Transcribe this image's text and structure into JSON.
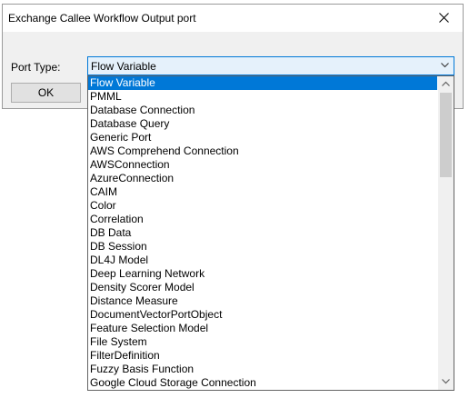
{
  "window": {
    "title": "Exchange Callee Workflow Output port",
    "close_icon": "close-icon"
  },
  "form": {
    "port_type_label": "Port Type:",
    "ok_label": "OK",
    "selected_value": "Flow Variable"
  },
  "dropdown": {
    "items": [
      "Flow Variable",
      "PMML",
      "Database Connection",
      "Database Query",
      "Generic Port",
      "AWS Comprehend Connection",
      "AWSConnection",
      "AzureConnection",
      "CAIM",
      "Color",
      "Correlation",
      "DB Data",
      "DB Session",
      "DL4J Model",
      "Deep Learning Network",
      "Density Scorer Model",
      "Distance Measure",
      "DocumentVectorPortObject",
      "Feature Selection Model",
      "File System",
      "FilterDefinition",
      "Fuzzy Basis Function",
      "Google Cloud Storage Connection"
    ],
    "selected_index": 0
  },
  "colors": {
    "accent": "#0078d7",
    "dialog_bg": "#f0f0f0",
    "combo_bg": "#e5f1fb"
  }
}
